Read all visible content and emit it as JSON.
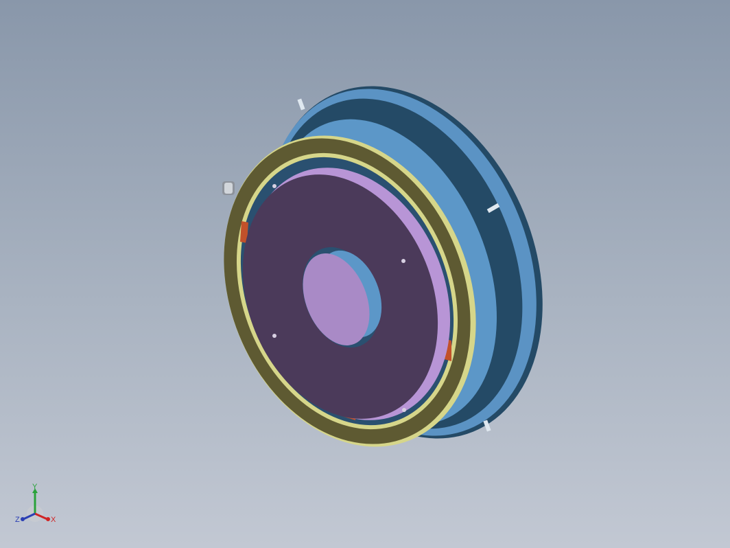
{
  "viewport": {
    "name": "3D model view",
    "background_top": "#8997aa",
    "background_bottom": "#c2c8d3"
  },
  "model": {
    "parts": [
      {
        "name": "outer-flange-housing",
        "color": "#5b93c4",
        "shadow_color": "#244a66"
      },
      {
        "name": "friction-ring",
        "color": "#5e5a32",
        "highlight_color": "#d6d68a"
      },
      {
        "name": "armature-disc",
        "color": "#4b3a5a",
        "side_color": "#b895d6"
      },
      {
        "name": "hub-bore",
        "color": "#a98ac6"
      },
      {
        "name": "spring-blocks",
        "color": "#c2512a"
      },
      {
        "name": "bolt-head",
        "color": "#b9bec6"
      }
    ]
  },
  "triad": {
    "x_label": "X",
    "y_label": "Y",
    "z_label": "Z",
    "x_color": "#d02424",
    "y_color": "#2aa23a",
    "z_color": "#2b3fb4"
  }
}
